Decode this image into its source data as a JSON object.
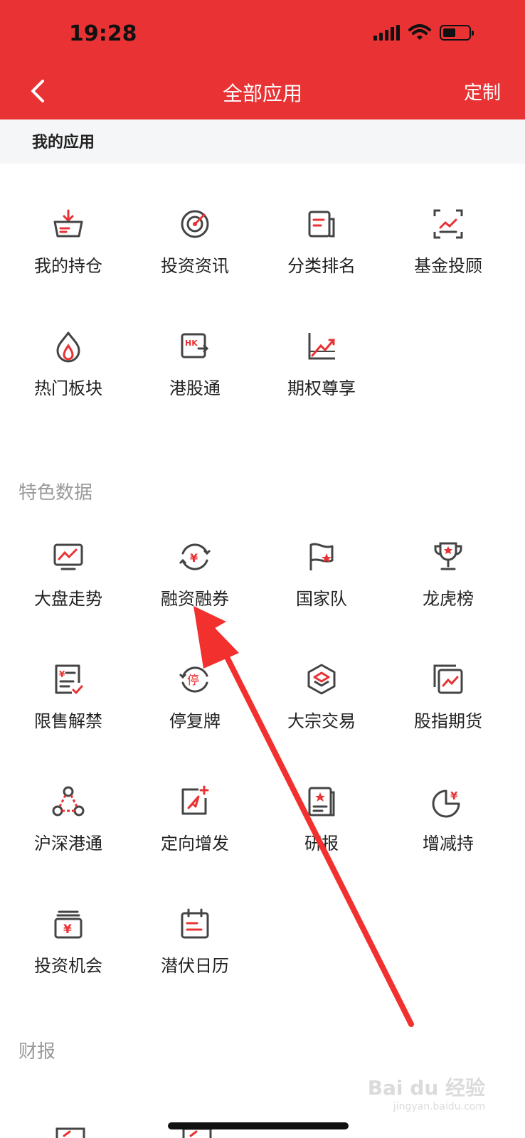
{
  "status": {
    "time": "19:28"
  },
  "nav": {
    "title": "全部应用",
    "custom": "定制",
    "back_icon": "chevron-left-icon"
  },
  "mine": {
    "title": "我的应用",
    "apps": [
      {
        "label": "我的持仓",
        "icon": "holdings-icon"
      },
      {
        "label": "投资资讯",
        "icon": "target-icon"
      },
      {
        "label": "分类排名",
        "icon": "ranking-icon"
      },
      {
        "label": "基金投顾",
        "icon": "fund-advisor-icon"
      },
      {
        "label": "热门板块",
        "icon": "flame-icon"
      },
      {
        "label": "港股通",
        "icon": "hk-connect-icon"
      },
      {
        "label": "期权尊享",
        "icon": "options-icon"
      }
    ]
  },
  "featured": {
    "title": "特色数据",
    "apps": [
      {
        "label": "大盘走势",
        "icon": "market-trend-icon"
      },
      {
        "label": "融资融券",
        "icon": "margin-trading-icon"
      },
      {
        "label": "国家队",
        "icon": "flag-icon"
      },
      {
        "label": "龙虎榜",
        "icon": "trophy-icon"
      },
      {
        "label": "限售解禁",
        "icon": "unlock-list-icon"
      },
      {
        "label": "停复牌",
        "icon": "suspension-icon"
      },
      {
        "label": "大宗交易",
        "icon": "block-trade-icon"
      },
      {
        "label": "股指期货",
        "icon": "index-futures-icon"
      },
      {
        "label": "沪深港通",
        "icon": "connect-icon"
      },
      {
        "label": "定向增发",
        "icon": "placement-icon"
      },
      {
        "label": "研报",
        "icon": "report-icon"
      },
      {
        "label": "增减持",
        "icon": "pie-yuan-icon"
      },
      {
        "label": "投资机会",
        "icon": "opportunity-icon"
      },
      {
        "label": "潜伏日历",
        "icon": "calendar-icon"
      }
    ]
  },
  "finance": {
    "title": "财报"
  },
  "watermark": {
    "brand": "Bai du 经验",
    "url": "jingyan.baidu.com"
  },
  "colors": {
    "header": "#E83234",
    "accent": "#E83234",
    "icon": "#444444"
  }
}
